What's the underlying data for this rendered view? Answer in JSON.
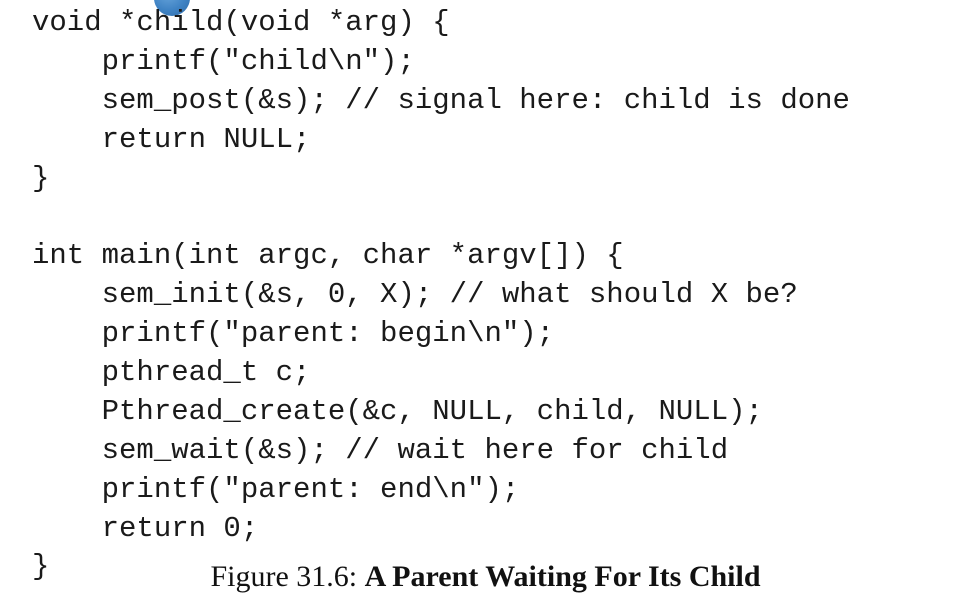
{
  "code_lines": [
    "void *child(void *arg) {",
    "    printf(\"child\\n\");",
    "    sem_post(&s); // signal here: child is done",
    "    return NULL;",
    "}",
    "",
    "int main(int argc, char *argv[]) {",
    "    sem_init(&s, 0, X); // what should X be?",
    "    printf(\"parent: begin\\n\");",
    "    pthread_t c;",
    "    Pthread_create(&c, NULL, child, NULL);",
    "    sem_wait(&s); // wait here for child",
    "    printf(\"parent: end\\n\");",
    "    return 0;",
    "}"
  ],
  "caption": {
    "label": "Figure 31.6: ",
    "title": "A Parent Waiting For Its Child"
  },
  "colors": {
    "marker": "#3f83c4",
    "text": "#1a1a1a"
  },
  "icons": {
    "marker": "blue-circle-marker-icon"
  }
}
